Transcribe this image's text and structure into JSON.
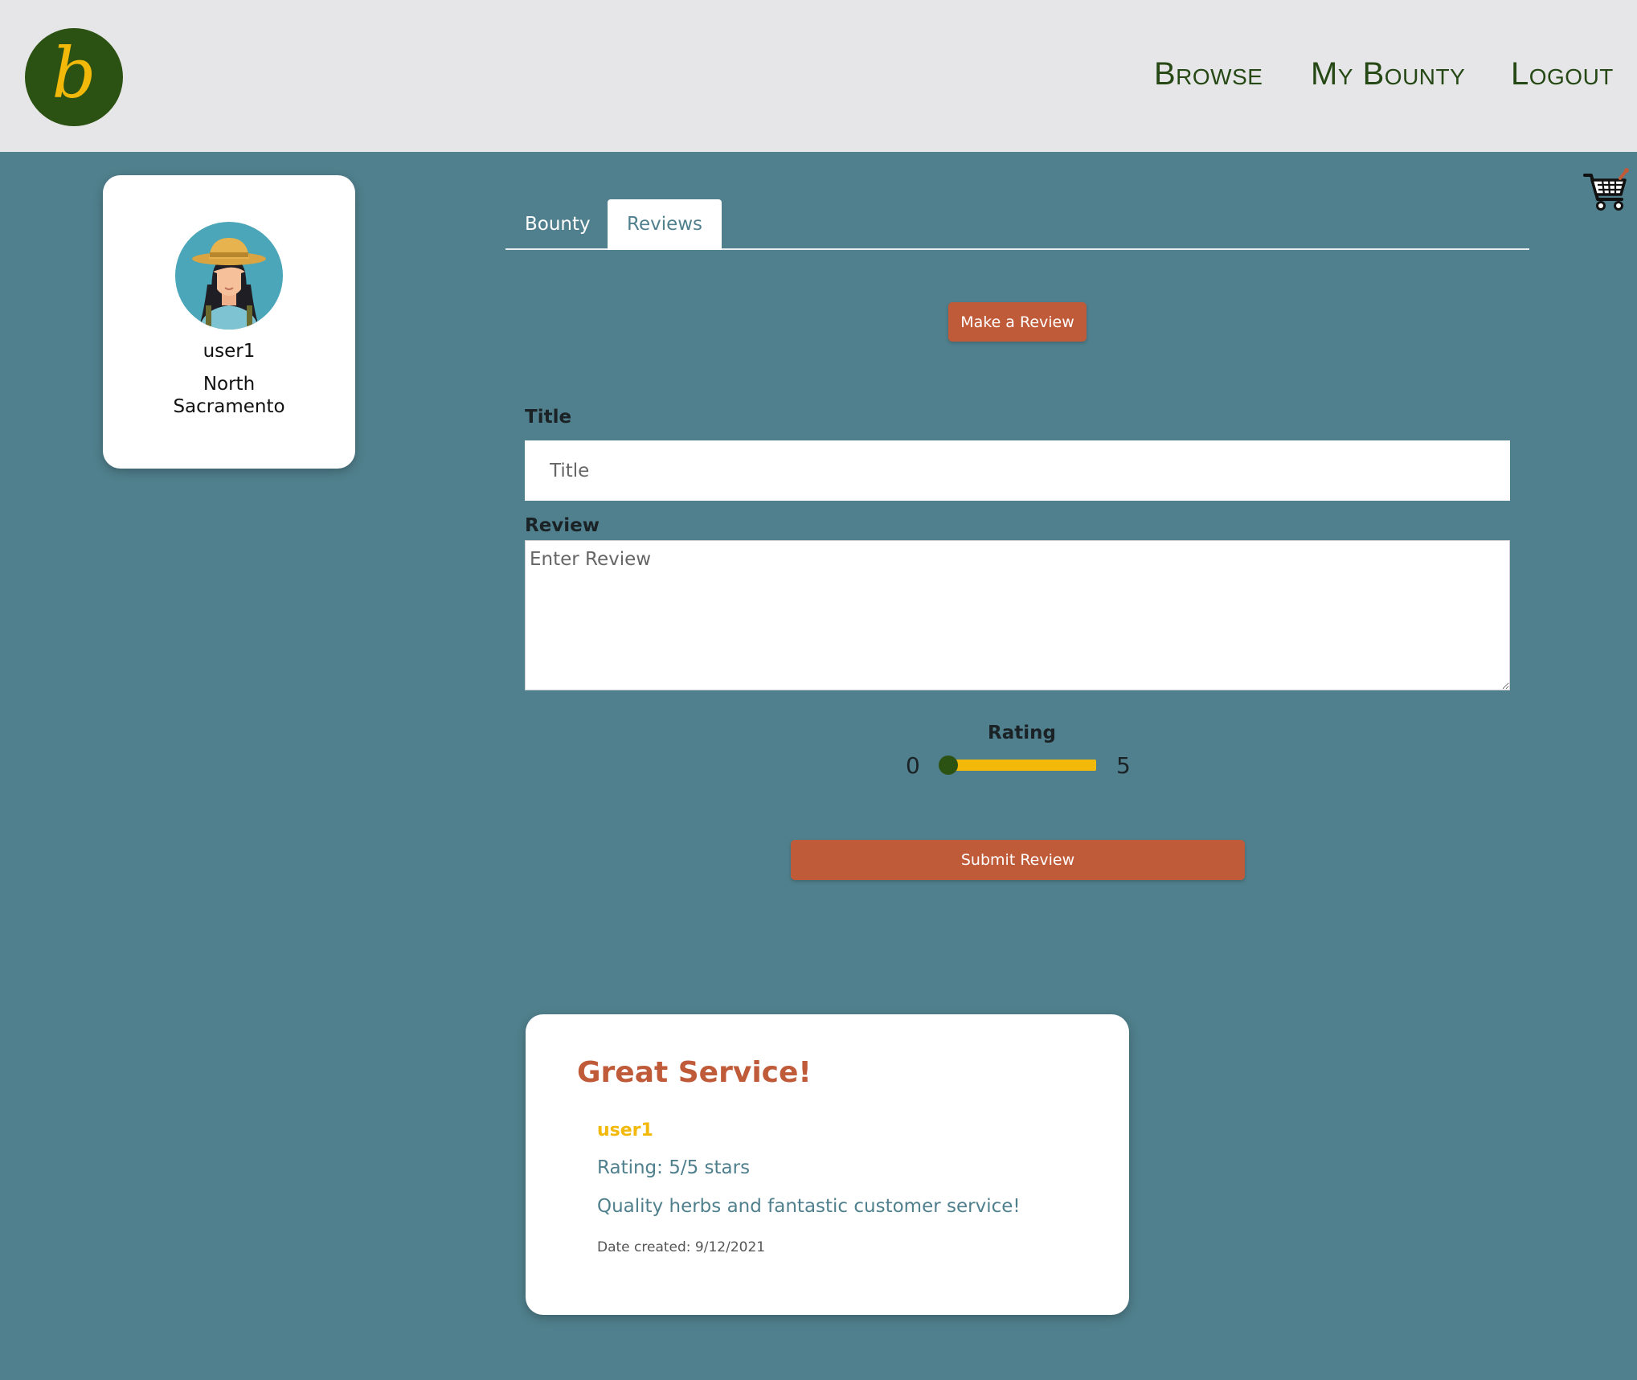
{
  "header": {
    "logo_letter": "b",
    "nav": {
      "browse": "Browse",
      "my_bounty": "My Bounty",
      "logout": "Logout"
    }
  },
  "cart": {
    "icon": "shopping-cart-icon"
  },
  "profile": {
    "username": "user1",
    "location": "North Sacramento",
    "avatar_icon": "farmer-avatar"
  },
  "tabs": [
    {
      "label": "Bounty",
      "active": false
    },
    {
      "label": "Reviews",
      "active": true
    }
  ],
  "review_form": {
    "make_review_label": "Make a Review",
    "title_label": "Title",
    "title_placeholder": "Title",
    "title_value": "",
    "review_label": "Review",
    "review_placeholder": "Enter Review",
    "review_value": "",
    "rating_label": "Rating",
    "rating_min": "0",
    "rating_max": "5",
    "rating_value": 0,
    "submit_label": "Submit Review"
  },
  "reviews": [
    {
      "title": "Great Service!",
      "user": "user1",
      "rating_text": "Rating: 5/5 stars",
      "body": "Quality herbs and fantastic customer service!",
      "date_text": "Date created: 9/12/2021"
    }
  ],
  "colors": {
    "background": "#50808d",
    "header": "#e6e6e8",
    "brand_green": "#2c5213",
    "accent_orange": "#c05b39",
    "accent_yellow": "#f2b90a"
  }
}
